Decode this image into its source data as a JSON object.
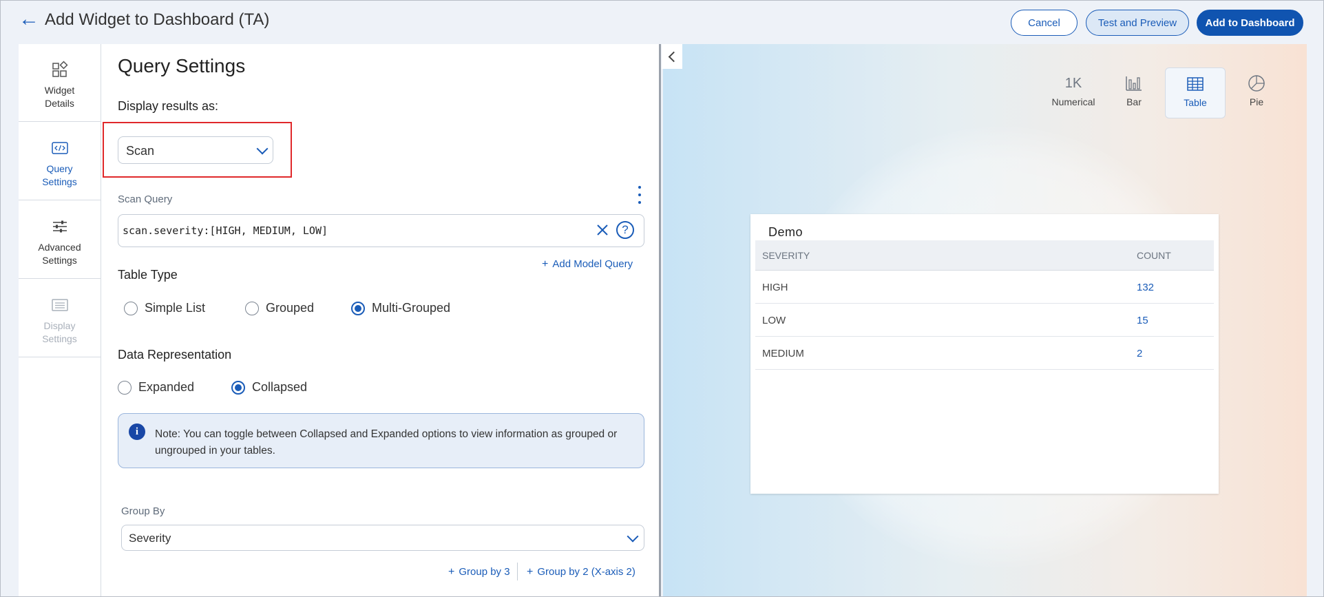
{
  "header": {
    "title": "Add Widget to Dashboard (TA)",
    "cancel_label": "Cancel",
    "test_label": "Test and Preview",
    "add_label": "Add to Dashboard"
  },
  "sidenav": {
    "items": [
      {
        "label": "Widget\nDetails",
        "icon": "widget-details-icon",
        "state": "normal"
      },
      {
        "label": "Query\nSettings",
        "icon": "code-icon",
        "state": "active"
      },
      {
        "label": "Advanced\nSettings",
        "icon": "sliders-icon",
        "state": "normal"
      },
      {
        "label": "Display\nSettings",
        "icon": "display-icon",
        "state": "disabled"
      }
    ]
  },
  "query": {
    "title": "Query Settings",
    "display_results_label": "Display results as:",
    "display_results_value": "Scan",
    "scan_query_label": "Scan Query",
    "scan_query_value": "scan.severity:[HIGH, MEDIUM, LOW]",
    "add_model_query": "Add Model Query",
    "table_type_label": "Table Type",
    "table_type_options": [
      "Simple List",
      "Grouped",
      "Multi-Grouped"
    ],
    "table_type_selected": "Multi-Grouped",
    "data_rep_label": "Data Representation",
    "data_rep_options": [
      "Expanded",
      "Collapsed"
    ],
    "data_rep_selected": "Collapsed",
    "note": "Note: You can toggle between Collapsed and Expanded options to view information as grouped or ungrouped in your tables.",
    "group_by_label": "Group By",
    "group_by_value": "Severity",
    "group_by_3": "Group by 3",
    "group_by_2": "Group by 2 (X-axis 2)"
  },
  "preview": {
    "chart_types": [
      {
        "glyph": "1K",
        "label": "Numerical"
      },
      {
        "glyph": "bar-chart-icon",
        "label": "Bar"
      },
      {
        "glyph": "table-icon",
        "label": "Table"
      },
      {
        "glyph": "pie-chart-icon",
        "label": "Pie"
      }
    ],
    "selected_chart_type": "Table",
    "card_title": "Demo",
    "columns": [
      "SEVERITY",
      "COUNT"
    ],
    "rows": [
      {
        "severity": "HIGH",
        "count": "132"
      },
      {
        "severity": "LOW",
        "count": "15"
      },
      {
        "severity": "MEDIUM",
        "count": "2"
      }
    ]
  },
  "colors": {
    "accent": "#1a5cb8",
    "highlight_box": "#e0282a",
    "primary_button": "#1054b0"
  }
}
